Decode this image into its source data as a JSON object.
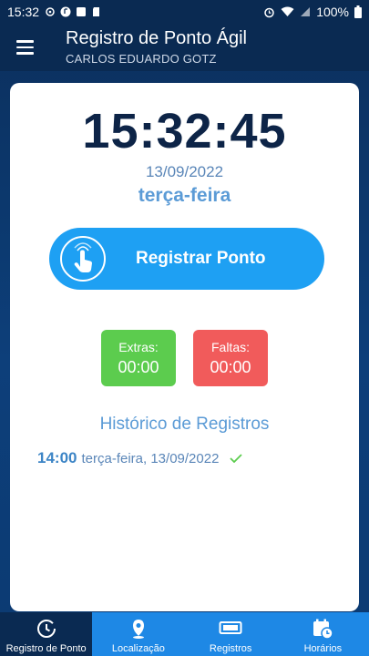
{
  "status_bar": {
    "time": "15:32",
    "battery": "100%"
  },
  "app_bar": {
    "title": "Registro de Ponto Ágil",
    "user": "CARLOS EDUARDO GOTZ"
  },
  "clock": {
    "time": "15:32:45",
    "date": "13/09/2022",
    "weekday": "terça-feira"
  },
  "register_button": {
    "label": "Registrar Ponto"
  },
  "stats": {
    "extras": {
      "label": "Extras:",
      "value": "00:00"
    },
    "faltas": {
      "label": "Faltas:",
      "value": "00:00"
    }
  },
  "history": {
    "title": "Histórico de Registros",
    "entries": [
      {
        "time": "14:00",
        "text": "terça-feira, 13/09/2022"
      }
    ]
  },
  "bottom_nav": {
    "items": [
      {
        "label": "Registro de Ponto",
        "icon": "clock-history-icon",
        "active": true
      },
      {
        "label": "Localização",
        "icon": "location-pin-icon",
        "active": false
      },
      {
        "label": "Registros",
        "icon": "time-clock-icon",
        "active": false
      },
      {
        "label": "Horários",
        "icon": "calendar-clock-icon",
        "active": false
      }
    ]
  },
  "colors": {
    "accent": "#1ea0f3",
    "extras": "#5ccc4e",
    "faltas": "#f15b5b",
    "dark_blue": "#0a2a52"
  }
}
